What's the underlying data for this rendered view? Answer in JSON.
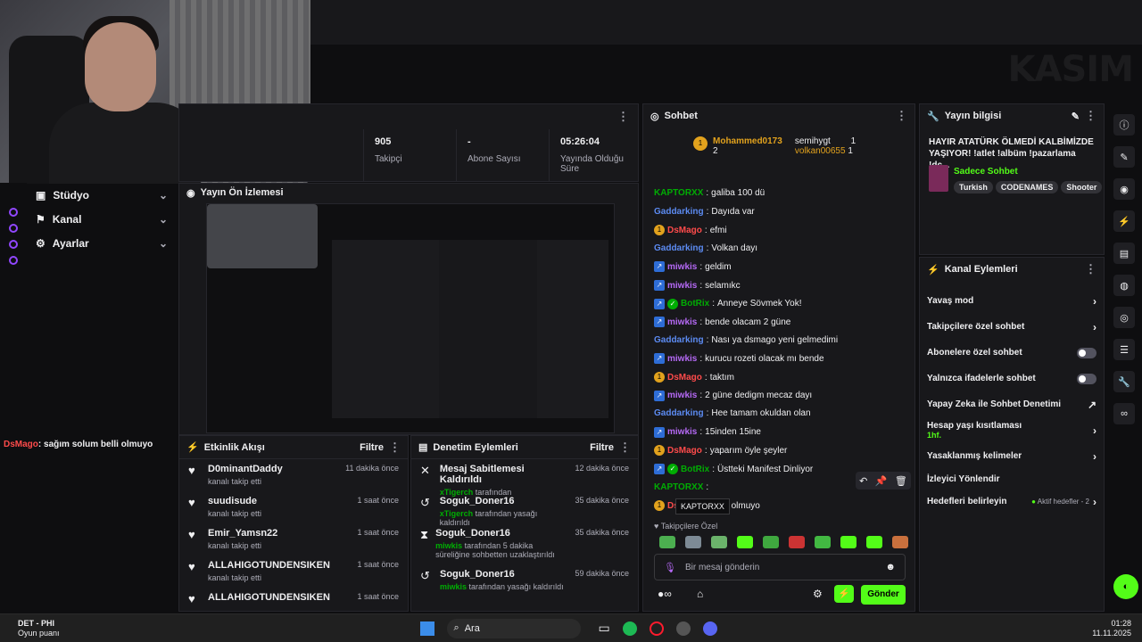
{
  "header": {
    "date_overlay": "KASIM"
  },
  "nav": {
    "items": [
      {
        "label": "Stüdyo"
      },
      {
        "label": "Kanal"
      },
      {
        "label": "Ayarlar"
      }
    ]
  },
  "stats": [
    {
      "value": "905",
      "label": "Takipçi"
    },
    {
      "value": "-",
      "label": "Abone Sayısı"
    },
    {
      "value": "05:26:04",
      "label": "Yayında Olduğu Süre"
    }
  ],
  "preview": {
    "title": "Yayın Ön İzlemesi"
  },
  "overlay_chat": {
    "user": "DsMago",
    "text": ": sağım solum belli olmuyo"
  },
  "activity": {
    "title": "Etkinlik Akışı",
    "filter": "Filtre",
    "items": [
      {
        "name": "D0minantDaddy",
        "sub": "kanalı takip etti",
        "time": "11 dakika önce"
      },
      {
        "name": "suudisude",
        "sub": "kanalı takip etti",
        "time": "1 saat önce"
      },
      {
        "name": "Emir_Yamsn22",
        "sub": "kanalı takip etti",
        "time": "1 saat önce"
      },
      {
        "name": "ALLAHIGOTUNDENSIKEN",
        "sub": "kanalı takip etti",
        "time": "1 saat önce"
      },
      {
        "name": "ALLAHIGOTUNDENSIKEN",
        "sub": "",
        "time": "1 saat önce"
      }
    ]
  },
  "moderation": {
    "title": "Denetim Eylemleri",
    "filter": "Filtre",
    "items": [
      {
        "name": "Mesaj Sabitlemesi Kaldırıldı",
        "actor": "xTigerch",
        "sub": " tarafından",
        "time": "12 dakika önce"
      },
      {
        "name": "Soguk_Doner16",
        "actor": "xTigerch",
        "sub": " tarafından yasağı kaldırıldı",
        "time": "35 dakika önce"
      },
      {
        "name": "Soguk_Doner16",
        "actor": "miwkis",
        "sub": " tarafından 5 dakika süreliğine sohbetten uzaklaştırıldı",
        "time": "35 dakika önce"
      },
      {
        "name": "Soguk_Doner16",
        "actor": "miwkis",
        "sub": " tarafından yasağı kaldırıldı",
        "time": "59 dakika önce"
      }
    ]
  },
  "chat": {
    "title": "Sohbet",
    "leaderboard": [
      {
        "rank": "1",
        "name": "Mohammed0173",
        "count": "2"
      },
      {
        "name": "semihygt",
        "count": "1"
      },
      {
        "name": "volkan00655",
        "count": "1"
      }
    ],
    "messages": [
      {
        "user": "KAPTORXX",
        "color": "#00ad03",
        "text": "galiba 100 dü"
      },
      {
        "user": "Gaddarking",
        "color": "#5c8bf2",
        "text": "Dayıda var"
      },
      {
        "user": "DsMago",
        "color": "#ff4b4b",
        "text": "efmi"
      },
      {
        "user": "Gaddarking",
        "color": "#5c8bf2",
        "text": "Volkan dayı"
      },
      {
        "user": "miwkis",
        "color": "#b569f5",
        "text": "geldim"
      },
      {
        "user": "miwkis",
        "color": "#b569f5",
        "text": "selamıkc"
      },
      {
        "user": "BotRix",
        "color": "#00ad03",
        "text": "Anneye Sövmek Yok!"
      },
      {
        "user": "miwkis",
        "color": "#b569f5",
        "text": "bende olacam 2 güne"
      },
      {
        "user": "Gaddarking",
        "color": "#5c8bf2",
        "text": "Nası ya dsmago yeni gelmedimi"
      },
      {
        "user": "miwkis",
        "color": "#b569f5",
        "text": "kurucu rozeti olacak mı bende"
      },
      {
        "user": "DsMago",
        "color": "#ff4b4b",
        "text": "taktım"
      },
      {
        "user": "miwkis",
        "color": "#b569f5",
        "text": "2 güne dedigm mecaz dayı"
      },
      {
        "user": "Gaddarking",
        "color": "#5c8bf2",
        "text": "Hee tamam okuldan olan"
      },
      {
        "user": "miwkis",
        "color": "#b569f5",
        "text": "15inden 15ine"
      },
      {
        "user": "DsMago",
        "color": "#ff4b4b",
        "text": "yaparım öyle şeyler"
      },
      {
        "user": "BotRix",
        "color": "#00ad03",
        "text": "Üstteki Manifest Dinliyor"
      },
      {
        "user": "KAPTORXX",
        "color": "#00ad03",
        "text": ""
      },
      {
        "user": "Ds",
        "color": "#ff4b4b",
        "text": "solum belli olmuyo"
      }
    ],
    "tooltip": "KAPTORXX",
    "followers_only": "Takipçilere Özel",
    "placeholder": "Bir mesaj gönderin",
    "send": "Gönder"
  },
  "stream_info": {
    "title": "Yayın bilgisi",
    "stream_title": "HAYIR ATATÜRK ÖLMEDİ KALBİMİZDE YAŞIYOR! !atlet !albüm !pazarlama !dc...",
    "category": "Sadece Sohbet",
    "tags": [
      "Turkish",
      "CODENAMES",
      "Shooter"
    ]
  },
  "channel_actions": {
    "title": "Kanal Eylemleri",
    "items": [
      {
        "label": "Yavaş mod",
        "type": "arrow"
      },
      {
        "label": "Takipçilere özel sohbet",
        "type": "arrow"
      },
      {
        "label": "Abonelere özel sohbet",
        "type": "toggle"
      },
      {
        "label": "Yalnızca ifadelerle sohbet",
        "type": "toggle"
      },
      {
        "label": "Yapay Zeka ile Sohbet Denetimi",
        "type": "ext"
      },
      {
        "label": "Hesap yaşı kısıtlaması",
        "sub": "1hf.",
        "type": "arrow"
      },
      {
        "label": "Yasaklanmış kelimeler",
        "type": "arrow"
      },
      {
        "label": "İzleyici Yönlendir",
        "type": "none"
      },
      {
        "label": "Hedefleri belirleyin",
        "extra": "Aktif hedefler - 2",
        "type": "arrow"
      }
    ]
  },
  "taskbar": {
    "app": "DET - PHI",
    "app_sub": "Oyun puanı",
    "search": "Ara",
    "time": "01:28",
    "date": "11.11.2025"
  },
  "colors": {
    "accent": "#53fc18",
    "kick_green": "#00ad03"
  }
}
